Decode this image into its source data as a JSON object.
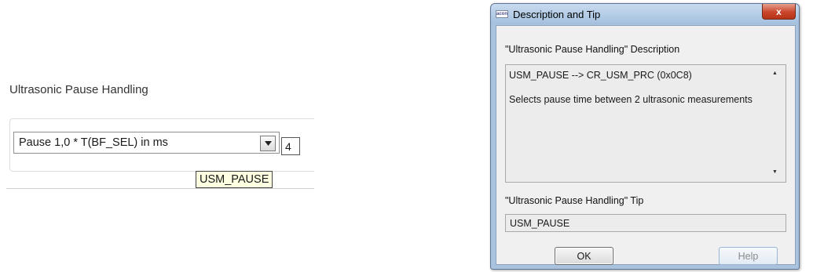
{
  "left_panel": {
    "section_title": "Ultrasonic Pause Handling",
    "combo_value": "Pause 1,0 * T(BF_SEL) in ms",
    "numeric_value": "4",
    "tooltip": "USM_PAUSE"
  },
  "dialog": {
    "icon_label": "acon",
    "title": "Description and Tip",
    "close_glyph": "x",
    "description_heading": "\"Ultrasonic Pause Handling\" Description",
    "description_lines": [
      "USM_PAUSE --> CR_USM_PRC (0x0C8)",
      "Selects pause time between 2 ultrasonic measurements"
    ],
    "tip_heading": "\"Ultrasonic Pause Handling\" Tip",
    "tip_value": "USM_PAUSE",
    "ok_label": "OK",
    "help_label": "Help"
  },
  "icons": [
    "dropdown-arrow-icon",
    "app-icon",
    "close-icon",
    "scroll-up-icon",
    "scroll-down-icon"
  ],
  "colors": {
    "tooltip_bg": "#ffffe1",
    "titlebar": "#a9c3de",
    "close_button": "#c9452b",
    "dialog_body": "#f0f0f0"
  }
}
